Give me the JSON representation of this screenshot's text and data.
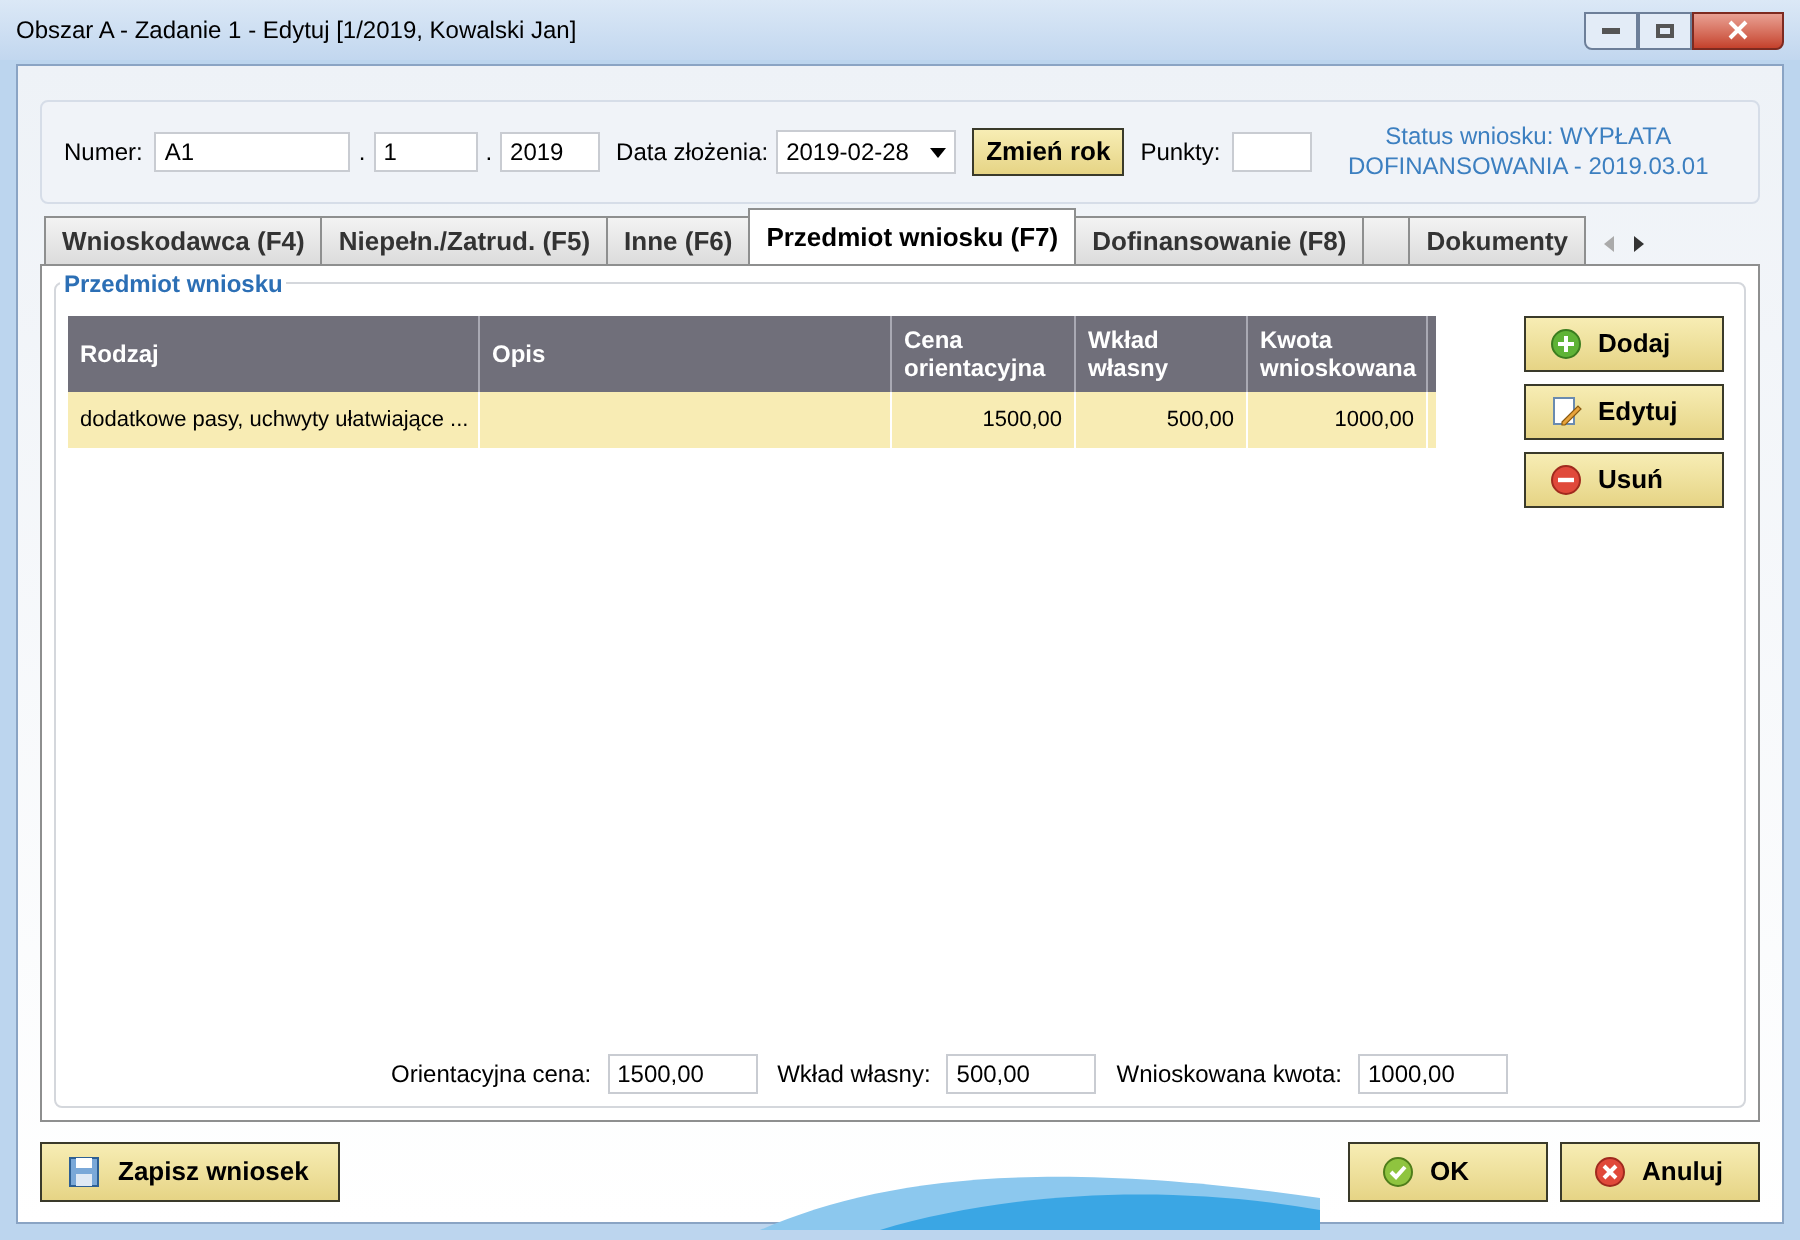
{
  "window": {
    "title": "Obszar A - Zadanie 1 - Edytuj  [1/2019, Kowalski Jan]"
  },
  "header": {
    "numer_label": "Numer:",
    "numer_parts": [
      "A1",
      "1",
      "2019"
    ],
    "separators": [
      ".",
      "."
    ],
    "date_label": "Data złożenia:",
    "date_value": "2019-02-28",
    "change_year_button": "Zmień rok",
    "points_label": "Punkty:",
    "status": [
      "Status wniosku: WYPŁATA",
      "DOFINANSOWANIA - 2019.03.01"
    ]
  },
  "tabs": [
    {
      "label": "Wnioskodawca (F4)",
      "selected": false
    },
    {
      "label": "Niepełn./Zatrud. (F5)",
      "selected": false
    },
    {
      "label": "Inne (F6)",
      "selected": false
    },
    {
      "label": "Przedmiot wniosku (F7)",
      "selected": true
    },
    {
      "label": "Dofinansowanie (F8)",
      "selected": false
    },
    {
      "selected": false
    },
    {
      "label": "Dokumenty",
      "selected": false
    }
  ],
  "group": {
    "title": "Przedmiot wniosku"
  },
  "table": {
    "columns": [
      "Rodzaj",
      "Opis",
      "Cena orientacyjna",
      "Wkład własny",
      "Kwota wnioskowana"
    ],
    "rows": [
      {
        "cells": [
          "dodatkowe pasy, uchwyty ułatwiające ...",
          "",
          "1500,00",
          "500,00",
          "1000,00"
        ],
        "selected": true
      }
    ]
  },
  "side_buttons": [
    {
      "label": "Dodaj",
      "kind": "add"
    },
    {
      "label": "Edytuj",
      "kind": "edit"
    },
    {
      "label": "Usuń",
      "kind": "remove"
    }
  ],
  "totals": [
    {
      "label": "Orientacyjna cena:",
      "value": "1500,00"
    },
    {
      "label": "Wkład własny:",
      "value": "500,00"
    },
    {
      "label": "Wnioskowana kwota:",
      "value": "1000,00"
    }
  ],
  "save_button": "Zapisz wniosek",
  "ok_button": "OK",
  "cancel_button": "Anuluj"
}
